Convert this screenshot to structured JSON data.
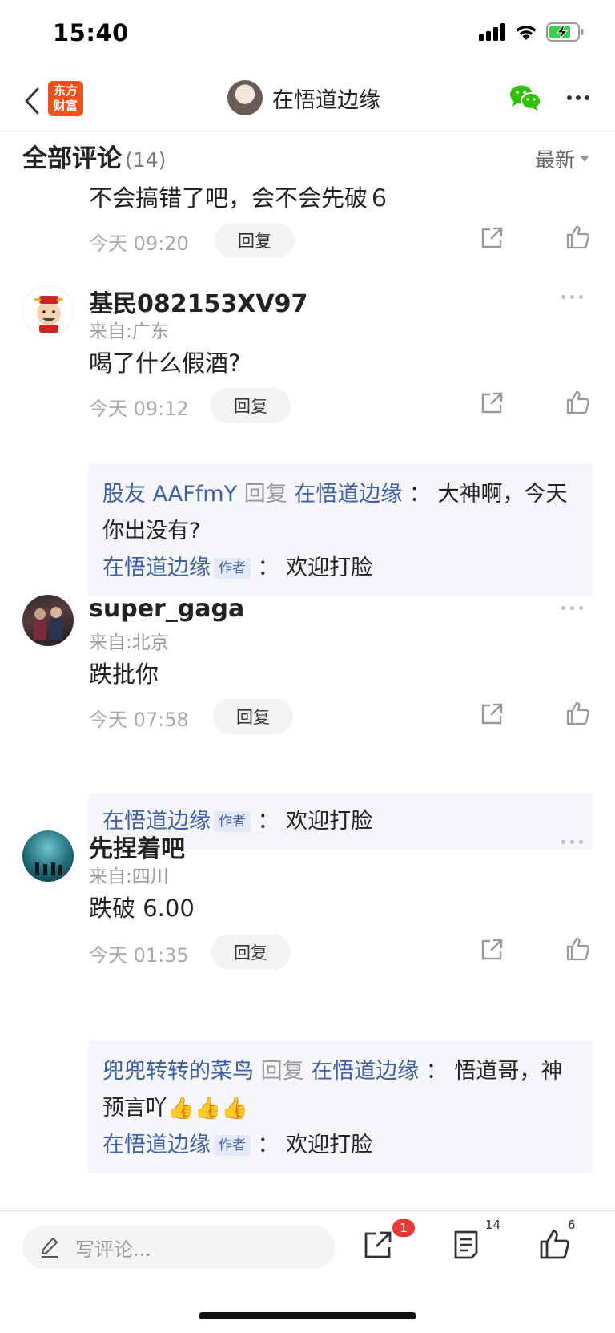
{
  "status_bar": {
    "time": "15:40"
  },
  "nav": {
    "logo_line1": "东方",
    "logo_line2": "财富",
    "title": "在悟道边缘"
  },
  "header": {
    "title": "全部评论",
    "count": "(14)",
    "sort_label": "最新"
  },
  "comments": [
    {
      "text": "不会搞错了吧，会不会先破６",
      "time": "今天 09:20",
      "reply_label": "回复"
    },
    {
      "username": "基民082153XV97",
      "location": "来自:广东",
      "text": "喝了什么假酒?",
      "time": "今天 09:12",
      "reply_label": "回复",
      "replies": {
        "user": "股友 AAFfmY",
        "reply_word": "回复",
        "target": "在悟道边缘",
        "sep": "：",
        "text": "大神啊，今天你出没有?",
        "author": "在悟道边缘",
        "author_tag": "作者",
        "author_sep": "：",
        "author_text": "欢迎打脸"
      }
    },
    {
      "username": "super_gaga",
      "location": "来自:北京",
      "text": "跌批你",
      "time": "今天 07:58",
      "reply_label": "回复",
      "replies": {
        "author": "在悟道边缘",
        "author_tag": "作者",
        "author_sep": "：",
        "author_text": "欢迎打脸"
      }
    },
    {
      "username": "先捏着吧",
      "location": "来自:四川",
      "text": "跌破 6.00",
      "time": "今天 01:35",
      "reply_label": "回复",
      "replies": {
        "user": "兜兜转转的菜鸟",
        "reply_word": "回复",
        "target": "在悟道边缘",
        "sep": "：",
        "text": "悟道哥，神预言吖👍👍👍",
        "author": "在悟道边缘",
        "author_tag": "作者",
        "author_sep": "：",
        "author_text": "欢迎打脸"
      }
    }
  ],
  "bottom_bar": {
    "input_placeholder": "写评论...",
    "share_badge": "1",
    "comment_count": "14",
    "like_count": "6"
  },
  "icons": {
    "back": "chevron-left-icon",
    "wechat": "wechat-icon",
    "more": "more-icon",
    "share": "share-icon",
    "like": "thumbs-up-icon",
    "edit": "pencil-icon",
    "comments": "comment-list-icon"
  },
  "colors": {
    "link_blue": "#3f5f9e",
    "brand_orange": "#f0501e",
    "wechat_green": "#2dc100",
    "badge_red": "#e53935"
  }
}
